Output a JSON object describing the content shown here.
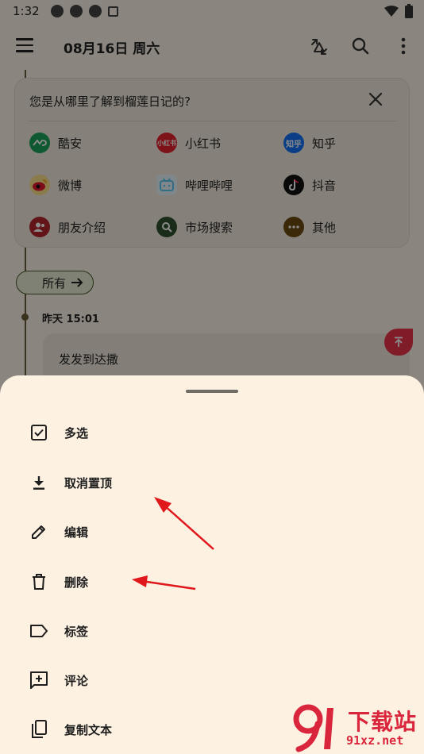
{
  "status_bar": {
    "time": "1:32"
  },
  "app_bar": {
    "title": "08月16日 周六"
  },
  "survey": {
    "question": "您是从哪里了解到榴莲日记的?",
    "options": [
      {
        "label": "酷安",
        "icon": "coolapk-icon",
        "color": "#1aa35a"
      },
      {
        "label": "小红书",
        "icon": "xiaohongshu-icon",
        "color": "#e3222e",
        "icon_text": "小红书"
      },
      {
        "label": "知乎",
        "icon": "zhihu-icon",
        "color": "#1772f6",
        "icon_text": "知乎"
      },
      {
        "label": "微博",
        "icon": "weibo-icon",
        "color": "#f5a623"
      },
      {
        "label": "哔哩哔哩",
        "icon": "bilibili-icon",
        "color": "#5bc6f1"
      },
      {
        "label": "抖音",
        "icon": "douyin-icon",
        "color": "#111111"
      },
      {
        "label": "朋友介绍",
        "icon": "friends-icon",
        "color": "#b3262f"
      },
      {
        "label": "市场搜索",
        "icon": "market-search-icon",
        "color": "#2f5130"
      },
      {
        "label": "其他",
        "icon": "other-icon",
        "color": "#6b4a12"
      }
    ]
  },
  "filter": {
    "label": "所有"
  },
  "entry": {
    "time": "昨天 15:01",
    "text": "发发到达撒"
  },
  "sheet": {
    "items": [
      {
        "label": "多选",
        "icon": "checkbox-icon"
      },
      {
        "label": "取消置顶",
        "icon": "unpin-download-icon"
      },
      {
        "label": "编辑",
        "icon": "pencil-icon"
      },
      {
        "label": "删除",
        "icon": "trash-icon"
      },
      {
        "label": "标签",
        "icon": "label-tag-icon"
      },
      {
        "label": "评论",
        "icon": "add-comment-icon"
      },
      {
        "label": "复制文本",
        "icon": "copy-icon"
      }
    ]
  },
  "watermark": {
    "title": "下载站",
    "url": "91xz.net"
  },
  "colors": {
    "sheet_bg": "#fdf1e2",
    "accent_red": "#e7344a",
    "chip_border": "#4a5a2a"
  }
}
